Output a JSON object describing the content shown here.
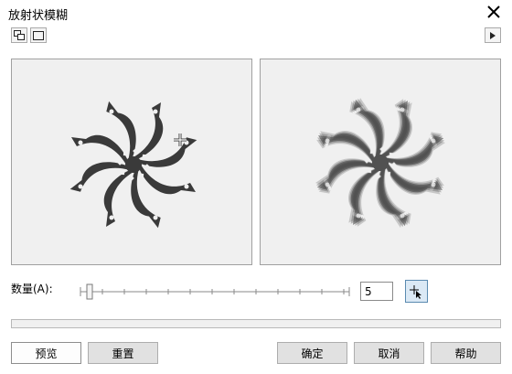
{
  "window": {
    "title": "放射状模糊"
  },
  "toolbar": {
    "icons": [
      "dual-preview-icon",
      "single-preview-icon",
      "expand-arrow-icon"
    ]
  },
  "controls": {
    "amount_label": "数量(A):",
    "amount_value": "5",
    "amount_min_marker": true
  },
  "progress": {
    "value": 0
  },
  "buttons": {
    "preview": "预览",
    "reset": "重置",
    "ok": "确定",
    "cancel": "取消",
    "help": "帮助"
  },
  "colors": {
    "shape": "#3a3a3a",
    "panel_bg": "#f0f0f0",
    "accent": "#5a8ab0"
  }
}
